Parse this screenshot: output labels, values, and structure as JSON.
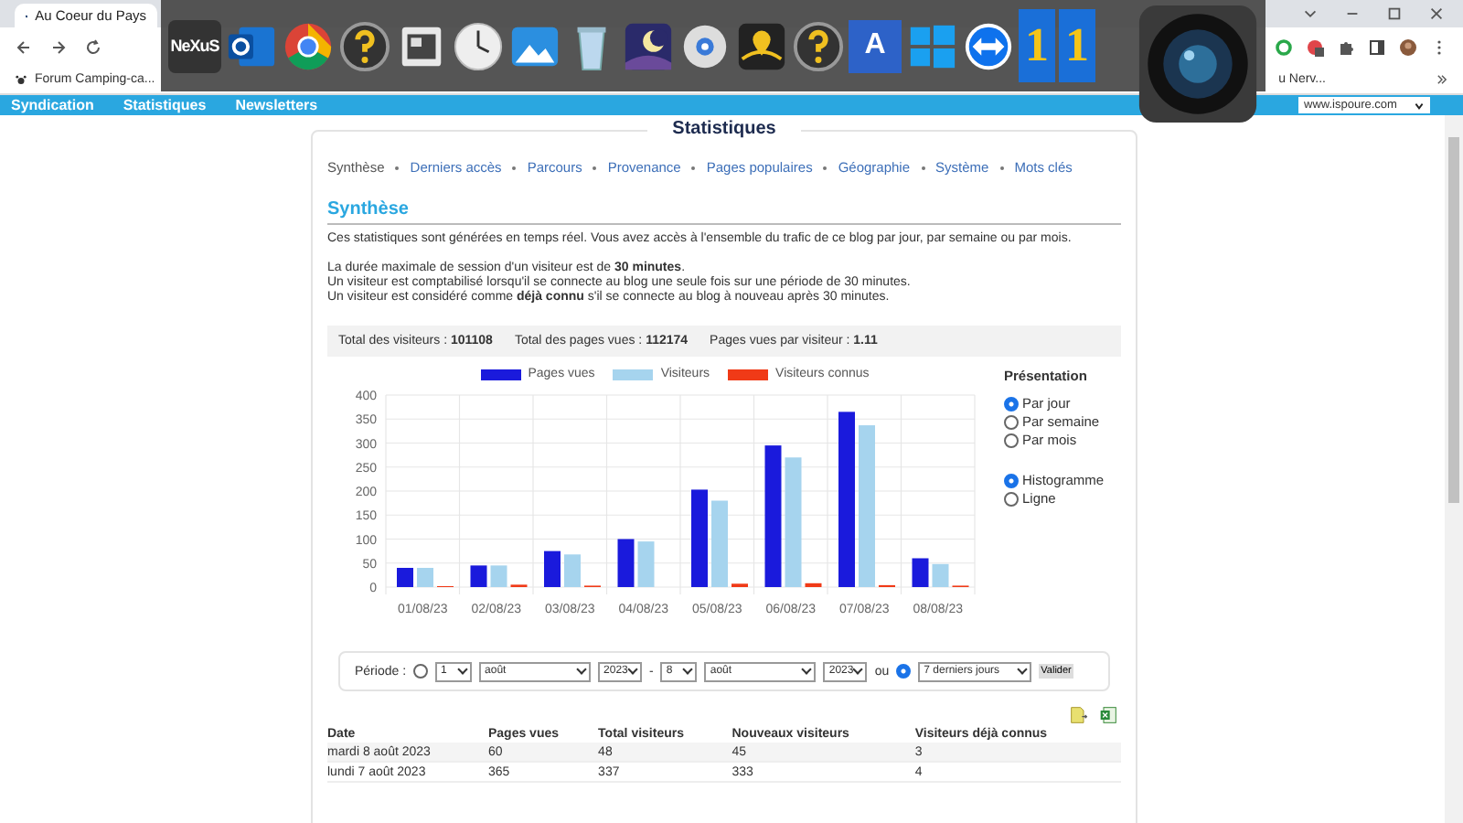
{
  "browser": {
    "tab_title": "Au Coeur du Pays",
    "bookmarks": [
      {
        "label": "Forum Camping-ca..."
      },
      {
        "label": "u Nerv..."
      }
    ]
  },
  "dock": {
    "items": [
      {
        "kind": "nexus",
        "label": "NeXuS"
      },
      {
        "kind": "outlook"
      },
      {
        "kind": "chrome"
      },
      {
        "kind": "help"
      },
      {
        "kind": "window"
      },
      {
        "kind": "clock"
      },
      {
        "kind": "photos"
      },
      {
        "kind": "bin"
      },
      {
        "kind": "night"
      },
      {
        "kind": "disk"
      },
      {
        "kind": "map"
      },
      {
        "kind": "help"
      },
      {
        "kind": "letter",
        "label": "A"
      },
      {
        "kind": "windows"
      },
      {
        "kind": "remote"
      },
      {
        "kind": "digit",
        "label": "1"
      },
      {
        "kind": "digit",
        "label": "1"
      },
      {
        "kind": "camera"
      }
    ]
  },
  "site_nav": {
    "items": [
      {
        "label": "Syndication"
      },
      {
        "label": "Statistiques"
      },
      {
        "label": "Newsletters"
      }
    ],
    "blog_select": "www.ispoure.com"
  },
  "stats": {
    "title": "Statistiques",
    "tabs": [
      {
        "label": "Synthèse",
        "selected": true
      },
      {
        "label": "Derniers accès",
        "selected": false
      },
      {
        "label": "Parcours",
        "selected": false
      },
      {
        "label": "Provenance",
        "selected": false
      },
      {
        "label": "Pages populaires",
        "selected": false
      },
      {
        "label": "Géographie",
        "selected": false
      },
      {
        "label": "Système",
        "selected": false
      },
      {
        "label": "Mots clés",
        "selected": false
      }
    ],
    "section_title": "Synthèse",
    "intro": "Ces statistiques sont générées en temps réel. Vous avez accès à l'ensemble du trafic de ce blog par jour, par semaine ou par mois.",
    "notes": [
      "La durée maximale de session d'un visiteur est de **30 minutes**.",
      "Un visiteur est comptabilisé lorsqu'il se connecte au blog une seule fois sur une période de 30 minutes.",
      "Un visiteur est considéré comme **déjà connu** s'il se connecte au blog à nouveau après 30 minutes."
    ],
    "totals": [
      {
        "label": "Total des visiteurs :",
        "value": "101108"
      },
      {
        "label": "Total des pages vues :",
        "value": "112174"
      },
      {
        "label": "Pages vues par visiteur :",
        "value": "1.11"
      }
    ],
    "chart_data": {
      "type": "bar",
      "categories": [
        "01/08/23",
        "02/08/23",
        "03/08/23",
        "04/08/23",
        "05/08/23",
        "06/08/23",
        "07/08/23",
        "08/08/23"
      ],
      "series": [
        {
          "name": "Pages vues",
          "color": "#1a1adc",
          "values": [
            40,
            45,
            75,
            100,
            203,
            295,
            365,
            60
          ]
        },
        {
          "name": "Visiteurs",
          "color": "#a6d4ee",
          "values": [
            40,
            45,
            68,
            95,
            180,
            270,
            337,
            48
          ]
        },
        {
          "name": "Visiteurs connus",
          "color": "#f03a17",
          "values": [
            2,
            5,
            3,
            0,
            7,
            8,
            4,
            3
          ]
        }
      ],
      "ylim": [
        0,
        400
      ],
      "grid": true,
      "yticks": [
        0,
        50,
        100,
        150,
        200,
        250,
        300,
        350,
        400
      ]
    },
    "presentation": {
      "title": "Présentation",
      "periods": [
        {
          "label": "Par jour",
          "selected": true
        },
        {
          "label": "Par semaine",
          "selected": false
        },
        {
          "label": "Par mois",
          "selected": false
        }
      ],
      "styles": [
        {
          "label": "Histogramme",
          "selected": true
        },
        {
          "label": "Ligne",
          "selected": false
        }
      ]
    },
    "period": {
      "label": "Période :",
      "range_selected": false,
      "from_day": "1",
      "from_month": "août",
      "from_year": "2023",
      "separator": "-",
      "to_day": "8",
      "to_month": "août",
      "to_year": "2023",
      "or": "ou",
      "preset_selected": true,
      "preset": "7 derniers jours",
      "submit": "Valider"
    },
    "table": {
      "columns": [
        "Date",
        "Pages vues",
        "Total visiteurs",
        "Nouveaux visiteurs",
        "Visiteurs déjà connus"
      ],
      "rows": [
        [
          "mardi 8 août 2023",
          "60",
          "48",
          "45",
          "3"
        ],
        [
          "lundi 7 août 2023",
          "365",
          "337",
          "333",
          "4"
        ]
      ]
    }
  }
}
